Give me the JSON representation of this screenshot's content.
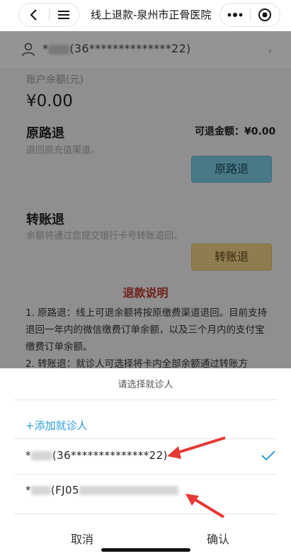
{
  "navbar": {
    "title": "线上退款-泉州市正骨医院",
    "back_icon": "chevron-left-icon",
    "menu_icon": "hamburger-menu-icon",
    "more_icon": "more-dots-icon",
    "close_icon": "target-close-icon"
  },
  "page": {
    "user": {
      "prefix": "*",
      "id_text": "(36**************22)"
    },
    "balance": {
      "label": "账户余额(元)",
      "value": "¥0.00"
    },
    "original_route": {
      "title": "原路退",
      "subtitle": "退回原充值渠道。",
      "refundable_label": "可退金额：¥0.00",
      "button": "原路退"
    },
    "transfer": {
      "title": "转账退",
      "subtitle": "余额将通过您提交银行卡号转账退回。",
      "button": "转账退"
    },
    "notes": {
      "title": "退款说明",
      "line1": "1. 原路退：线上可退余额将按原缴费渠道退回。目前支持退回一年内的微信缴费订单余额，以及三个月内的支付宝缴费订单余额。",
      "line2": "2. 转账退：就诊人可选择将卡内全部余额通过转账方"
    }
  },
  "sheet": {
    "title": "请选择就诊人",
    "add_label": "+添加就诊人",
    "options": [
      {
        "prefix": "*",
        "suffix": "(36**************22)",
        "selected": true
      },
      {
        "prefix": "*",
        "suffix": "(FJ05",
        "selected": false
      }
    ],
    "cancel": "取消",
    "confirm": "确认"
  },
  "colors": {
    "accent_blue": "#2e9bd6",
    "annotation_red": "#e53935",
    "button_blue": "#7fd0e9",
    "button_yellow": "#f6d789"
  }
}
